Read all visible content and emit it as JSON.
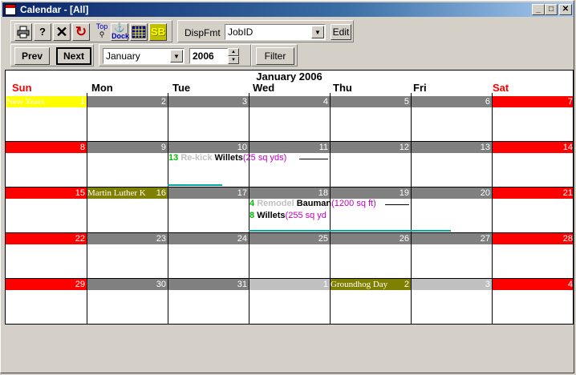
{
  "window": {
    "title": "Calendar - [All]"
  },
  "toolbar": {
    "top_label": "Top",
    "dock_label": "Dock",
    "sb_label": "SB",
    "dispfmt_label": "DispFmt",
    "dispfmt_value": "JobID",
    "edit_label": "Edit",
    "prev_label": "Prev",
    "next_label": "Next",
    "month_value": "January",
    "year_value": "2006",
    "filter_label": "Filter"
  },
  "calendar": {
    "title": "January 2006",
    "day_names": [
      "Sun",
      "Mon",
      "Tue",
      "Wed",
      "Thu",
      "Fri",
      "Sat"
    ],
    "weeks": [
      [
        "1",
        "2",
        "3",
        "4",
        "5",
        "6",
        "7"
      ],
      [
        "8",
        "9",
        "10",
        "11",
        "12",
        "13",
        "14"
      ],
      [
        "15",
        "16",
        "17",
        "18",
        "19",
        "20",
        "21"
      ],
      [
        "22",
        "23",
        "24",
        "25",
        "26",
        "27",
        "28"
      ],
      [
        "29",
        "30",
        "31",
        "1",
        "2",
        "3",
        "4"
      ]
    ],
    "holidays": {
      "new_years": "New Years",
      "mlk": "Martin Luther K",
      "groundhog": "Groundhog Day"
    },
    "events": [
      {
        "num": "13",
        "type": "Re-kick",
        "name": "Willets",
        "size": "(25 sq yds)"
      },
      {
        "num": "4",
        "type": "Remodel",
        "name": "Bauman",
        "size": "(1200 sq ft)"
      },
      {
        "num": "8",
        "type": "",
        "name": "Willets",
        "size": "(255 sq yd"
      }
    ],
    "colors": {
      "weekend": "#ff0000",
      "weekday": "#808080",
      "other_month": "#c0c0c0",
      "holiday_yellow": "#ffff00",
      "holiday_olive": "#808000"
    }
  }
}
